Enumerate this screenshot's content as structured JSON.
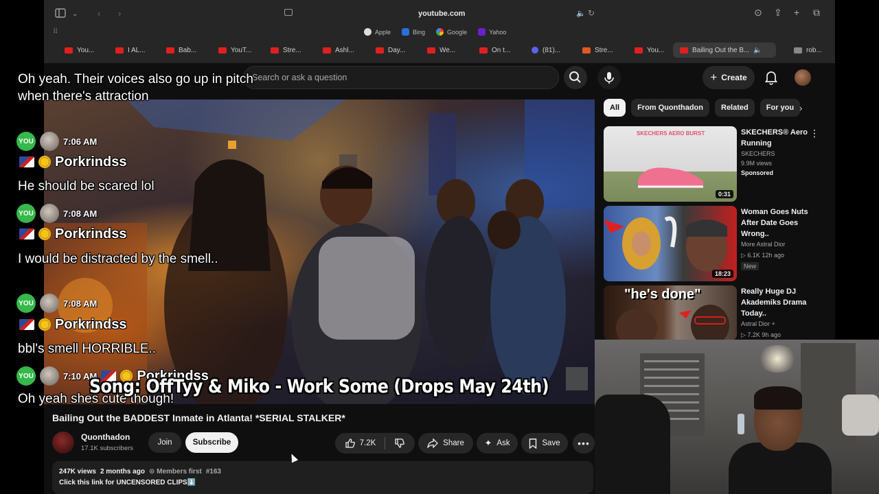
{
  "browser": {
    "url": "youtube.com",
    "favorites": [
      "Apple",
      "Bing",
      "Google",
      "Yahoo"
    ],
    "tabs": [
      "You...",
      "I AL...",
      "Bab...",
      "YouT...",
      "Stre...",
      "Ashl...",
      "Day...",
      "We...",
      "On t...",
      "(81)...",
      "Stre...",
      "You...",
      "Bailing Out the B...",
      "rob..."
    ]
  },
  "header": {
    "search_placeholder": "Search or ask a question",
    "create_label": "Create"
  },
  "video": {
    "title": "Bailing Out the BADDEST Inmate in Atlanta! *SERIAL STALKER*",
    "channel": "Quonthadon",
    "subscribers": "17.1K subscribers",
    "join_label": "Join",
    "subscribe_label": "Subscribe",
    "likes": "7.2K",
    "share_label": "Share",
    "ask_label": "Ask",
    "save_label": "Save",
    "views": "247K views",
    "age": "2 months ago",
    "members_first": "Members first",
    "hashtag": "#163",
    "description": "Click this link for UNCENSORED CLIPS⬇️"
  },
  "chips": [
    "All",
    "From Quonthadon",
    "Related",
    "For you"
  ],
  "recommendations": [
    {
      "title": "SKECHERS® Aero Running",
      "channel": "SKECHERS",
      "meta": "9.9M views",
      "badge": "Sponsored",
      "duration": "0:31"
    },
    {
      "title": "Woman Goes Nuts After Date Goes Wrong..",
      "channel": "More Astral Dior",
      "meta": "▷ 6.1K  12h ago",
      "badge": "New",
      "duration": "18:23"
    },
    {
      "title": "Really Huge DJ Akademiks Drama Today..",
      "channel": "Astral Dior +",
      "meta": "▷ 7.2K  9h ago",
      "thumb_text": "\"he's done\""
    }
  ],
  "thumb_brand": "SKECHERS AERO BURST",
  "chat": {
    "messages": [
      {
        "text": "Oh yeah. Their voices also go up in pitch when there's attraction"
      },
      {
        "time": "7:06 AM",
        "user": "Porkrindss",
        "text": "He should be scared lol"
      },
      {
        "time": "7:08 AM",
        "user": "Porkrindss",
        "text": "I would be distracted by the smell.."
      },
      {
        "time": "7:08 AM",
        "user": "Porkrindss",
        "text": "bbl's smell HORRIBLE.."
      },
      {
        "time": "7:10 AM",
        "user": "Porkrindss",
        "text": "Oh yeah shes cute though!"
      }
    ],
    "badge_label": "YOU"
  },
  "song_caption": "Song: OffTyy & Miko - Work Some (Drops May 24th)",
  "colors": {
    "youtube_red": "#ff0000",
    "chat_badge": "#36b84a",
    "page_bg": "#0f0f0f"
  }
}
